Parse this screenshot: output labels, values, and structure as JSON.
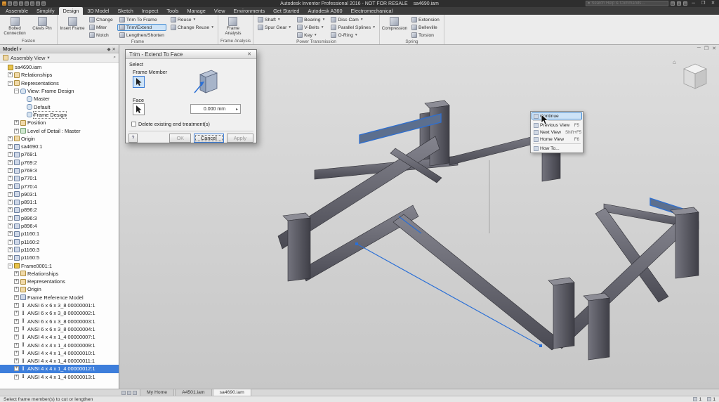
{
  "icons": {
    "close": "✕",
    "minimize": "─",
    "maximize": "❐",
    "search": "⌕",
    "dropdown": "▾",
    "help": "?",
    "pin": "◆",
    "home": "⌂",
    "stepper": "▸",
    "find": "⌕"
  },
  "titlebar": {
    "title": "Autodesk Inventor Professional 2016 - NOT FOR RESALE",
    "document": "sa4690.iam",
    "search_placeholder": "Search Help & Commands...",
    "quick_icons": [
      "app-logo",
      "new",
      "open",
      "save",
      "undo",
      "redo",
      "print",
      "update"
    ]
  },
  "ribbon": {
    "tabs": [
      "Assemble",
      "Simplify",
      "Design",
      "3D Model",
      "Sketch",
      "Inspect",
      "Tools",
      "Manage",
      "View",
      "Environments",
      "Get Started",
      "Autodesk A360",
      "Electromechanical"
    ],
    "active_tab": "Design",
    "highlighted_button": "Trim/Extend",
    "dropdown_buttons": [
      "Shaft",
      "Spur Gear",
      "Bearing",
      "V-Belts",
      "Key",
      "Disc Cam",
      "Parallel Splines",
      "O-Ring",
      "Reuse",
      "Change Reuse"
    ],
    "panels": [
      {
        "name": "Fasten",
        "large": [
          "Bolted Connection",
          "Clevis Pin"
        ],
        "columns": []
      },
      {
        "name": "Frame",
        "large": [
          "Insert Frame"
        ],
        "columns": [
          [
            "Change",
            "Miter",
            "Notch"
          ],
          [
            "Trim To Frame",
            "Trim/Extend",
            "Lengthen/Shorten"
          ],
          [
            "Reuse",
            "Change Reuse"
          ]
        ]
      },
      {
        "name": "Frame Analysis",
        "large": [
          "Frame Analysis"
        ],
        "columns": []
      },
      {
        "name": "Power Transmission",
        "large": [],
        "columns": [
          [
            "Shaft",
            "Spur Gear"
          ],
          [
            "Bearing",
            "V-Belts",
            "Key"
          ],
          [
            "Disc Cam",
            "Parallel Splines",
            "O-Ring"
          ]
        ]
      },
      {
        "name": "Spring",
        "large": [
          "Compression"
        ],
        "columns": [
          [
            "Extension",
            "Belleville",
            "Torsion"
          ]
        ]
      }
    ]
  },
  "browser": {
    "panel_title": "Model",
    "view_selector": "Assembly View",
    "tree": [
      {
        "l": "sa4690.iam",
        "i": 0,
        "ic": "asm",
        "exp": ""
      },
      {
        "l": "Relationships",
        "i": 1,
        "ic": "fold",
        "exp": "+"
      },
      {
        "l": "Representations",
        "i": 1,
        "ic": "fold",
        "exp": "-"
      },
      {
        "l": "View: Frame Design",
        "i": 2,
        "ic": "view",
        "exp": "-"
      },
      {
        "l": "Master",
        "i": 3,
        "ic": "view",
        "exp": ""
      },
      {
        "l": "Default",
        "i": 3,
        "ic": "view",
        "exp": ""
      },
      {
        "l": "Frame Design",
        "i": 3,
        "ic": "view",
        "exp": "",
        "boxed": true
      },
      {
        "l": "Position",
        "i": 2,
        "ic": "fold",
        "exp": "+"
      },
      {
        "l": "Level of Detail : Master",
        "i": 2,
        "ic": "lod",
        "exp": "+"
      },
      {
        "l": "Origin",
        "i": 1,
        "ic": "fold",
        "exp": "+"
      },
      {
        "l": "sa4690:1",
        "i": 1,
        "ic": "part",
        "exp": "+"
      },
      {
        "l": "p769:1",
        "i": 1,
        "ic": "part",
        "exp": "+"
      },
      {
        "l": "p769:2",
        "i": 1,
        "ic": "part",
        "exp": "+"
      },
      {
        "l": "p769:3",
        "i": 1,
        "ic": "part",
        "exp": "+"
      },
      {
        "l": "p770:1",
        "i": 1,
        "ic": "part",
        "exp": "+"
      },
      {
        "l": "p770:4",
        "i": 1,
        "ic": "part",
        "exp": "+"
      },
      {
        "l": "p903:1",
        "i": 1,
        "ic": "part",
        "exp": "+"
      },
      {
        "l": "p891:1",
        "i": 1,
        "ic": "part",
        "exp": "+"
      },
      {
        "l": "p896:2",
        "i": 1,
        "ic": "part",
        "exp": "+"
      },
      {
        "l": "p896:3",
        "i": 1,
        "ic": "part",
        "exp": "+"
      },
      {
        "l": "p896:4",
        "i": 1,
        "ic": "part",
        "exp": "+"
      },
      {
        "l": "p1160:1",
        "i": 1,
        "ic": "part",
        "exp": "+"
      },
      {
        "l": "p1160:2",
        "i": 1,
        "ic": "part",
        "exp": "+"
      },
      {
        "l": "p1160:3",
        "i": 1,
        "ic": "part",
        "exp": "+"
      },
      {
        "l": "p1160:5",
        "i": 1,
        "ic": "part",
        "exp": "+"
      },
      {
        "l": "Frame0001:1",
        "i": 1,
        "ic": "asm",
        "exp": "-"
      },
      {
        "l": "Relationships",
        "i": 2,
        "ic": "fold",
        "exp": "+"
      },
      {
        "l": "Representations",
        "i": 2,
        "ic": "fold",
        "exp": "+"
      },
      {
        "l": "Origin",
        "i": 2,
        "ic": "fold",
        "exp": "+"
      },
      {
        "l": "Frame Reference Model",
        "i": 2,
        "ic": "part",
        "exp": "+"
      },
      {
        "l": "ANSI 6 x 6 x 3_8 00000001:1",
        "i": 2,
        "ic": "beam",
        "exp": "+"
      },
      {
        "l": "ANSI 6 x 6 x 3_8 00000002:1",
        "i": 2,
        "ic": "beam",
        "exp": "+"
      },
      {
        "l": "ANSI 6 x 6 x 3_8 00000003:1",
        "i": 2,
        "ic": "beam",
        "exp": "+"
      },
      {
        "l": "ANSI 6 x 6 x 3_8 00000004:1",
        "i": 2,
        "ic": "beam",
        "exp": "+"
      },
      {
        "l": "ANSI 4 x 4 x 1_4 00000007:1",
        "i": 2,
        "ic": "beam",
        "exp": "+"
      },
      {
        "l": "ANSI 4 x 4 x 1_4 00000009:1",
        "i": 2,
        "ic": "beam",
        "exp": "+"
      },
      {
        "l": "ANSI 4 x 4 x 1_4 00000010:1",
        "i": 2,
        "ic": "beam",
        "exp": "+"
      },
      {
        "l": "ANSI 4 x 4 x 1_4 00000011:1",
        "i": 2,
        "ic": "beam",
        "exp": "+"
      },
      {
        "l": "ANSI 4 x 4 x 1_4 00000012:1",
        "i": 2,
        "ic": "beam",
        "exp": "+",
        "sel": true
      },
      {
        "l": "ANSI 4 x 4 x 1_4 00000013:1",
        "i": 2,
        "ic": "beam",
        "exp": "+"
      }
    ]
  },
  "dialog": {
    "title": "Trim - Extend To Face",
    "section_select": "Select",
    "frame_member_label": "Frame Member",
    "face_label": "Face",
    "offset_value": "0.000 mm",
    "checkbox_label": "Delete existing end treatment(s)",
    "ok": "OK",
    "cancel": "Cancel",
    "apply": "Apply"
  },
  "context_menu": {
    "items": [
      {
        "label": "Continue",
        "shortcut": "",
        "selected": true,
        "sep_after": true
      },
      {
        "label": "Previous View",
        "shortcut": "F5"
      },
      {
        "label": "Next View",
        "shortcut": "Shift+F5"
      },
      {
        "label": "Home View",
        "shortcut": "F6",
        "sep_after": true
      },
      {
        "label": "How To...",
        "shortcut": ""
      }
    ]
  },
  "doc_tabs": [
    {
      "label": "My Home",
      "active": false
    },
    {
      "label": "A4501.iam",
      "active": false
    },
    {
      "label": "sa4690.iam",
      "active": true
    }
  ],
  "statusbar": {
    "message": "Select frame member(s) to cut or lengthen",
    "counters": [
      "1",
      "1"
    ]
  }
}
